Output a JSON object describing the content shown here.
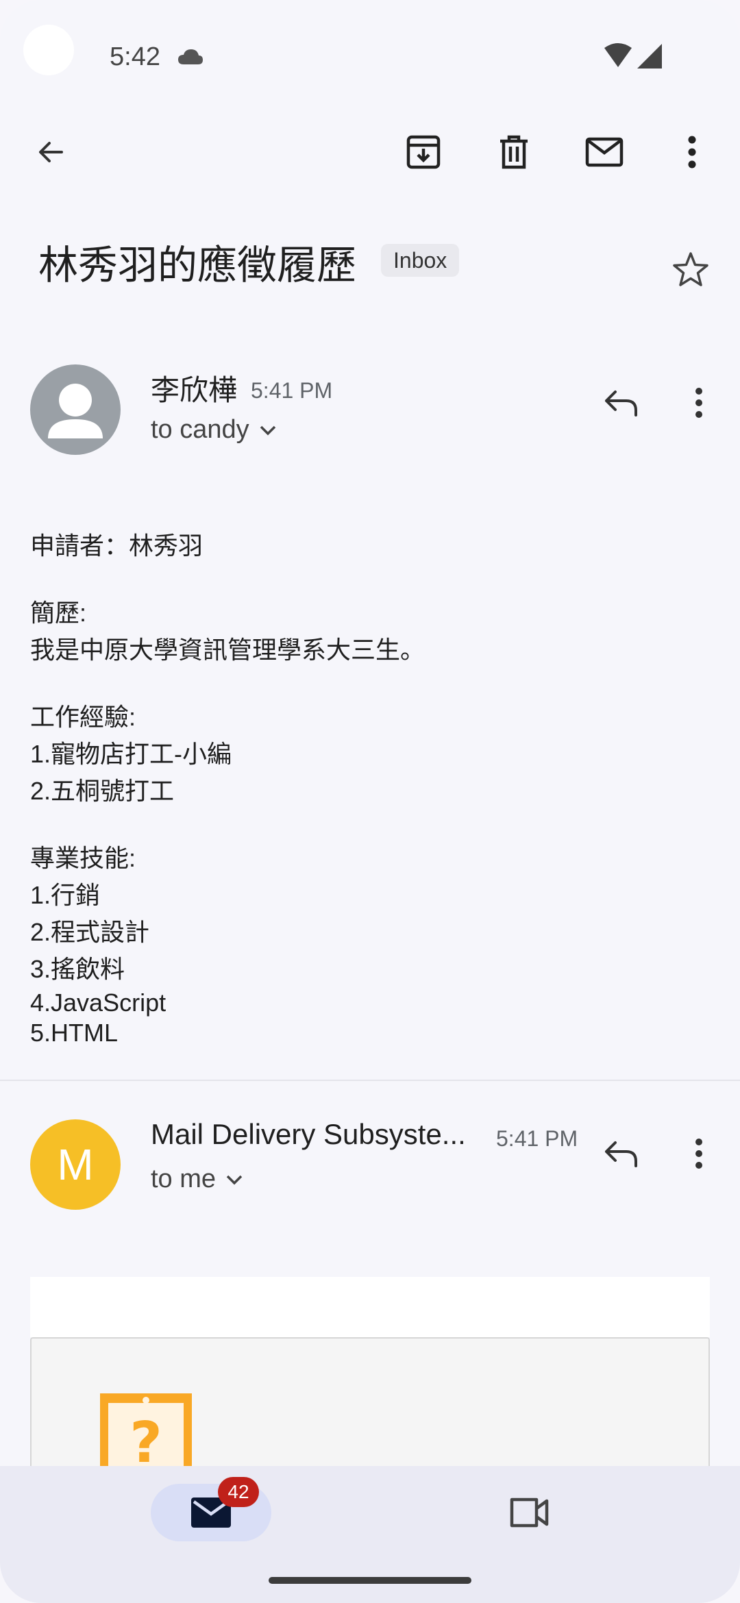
{
  "status_bar": {
    "time": "5:42"
  },
  "app_bar": {
    "back_icon": "arrow-back-icon",
    "archive_icon": "archive-icon",
    "delete_icon": "trash-icon",
    "unread_icon": "mail-icon",
    "more_icon": "more-vert-icon"
  },
  "subject": {
    "title": "林秀羽的應徵履歷",
    "label": "Inbox"
  },
  "messages": [
    {
      "sender": "李欣樺",
      "time": "5:41 PM",
      "recipient": "to candy",
      "avatar": "person-icon",
      "body": {
        "applicant": "申請者：林秀羽",
        "resume_heading": "簡歷:",
        "resume_text": "我是中原大學資訊管理學系大三生。",
        "experience_heading": "工作經驗:",
        "experience": [
          "1.寵物店打工-小編",
          "2.五桐號打工"
        ],
        "skills_heading": "專業技能:",
        "skills": [
          "1.行銷",
          "2.程式設計",
          "3.搖飲料",
          "4.JavaScript",
          "5.HTML"
        ]
      }
    },
    {
      "sender": "Mail Delivery Subsyste...",
      "time": "5:41 PM",
      "recipient": "to me",
      "avatar_letter": "M"
    }
  ],
  "bottom_nav": {
    "mail_badge": "42",
    "mail_icon": "mail-icon",
    "meet_icon": "video-camera-icon"
  },
  "colors": {
    "background": "#f6f6fb",
    "avatar_gray": "#9aa0a6",
    "avatar_yellow": "#f6bf26",
    "badge_red": "#c0211a",
    "nav_active": "#d9def6",
    "warning_orange": "#f9a825"
  }
}
